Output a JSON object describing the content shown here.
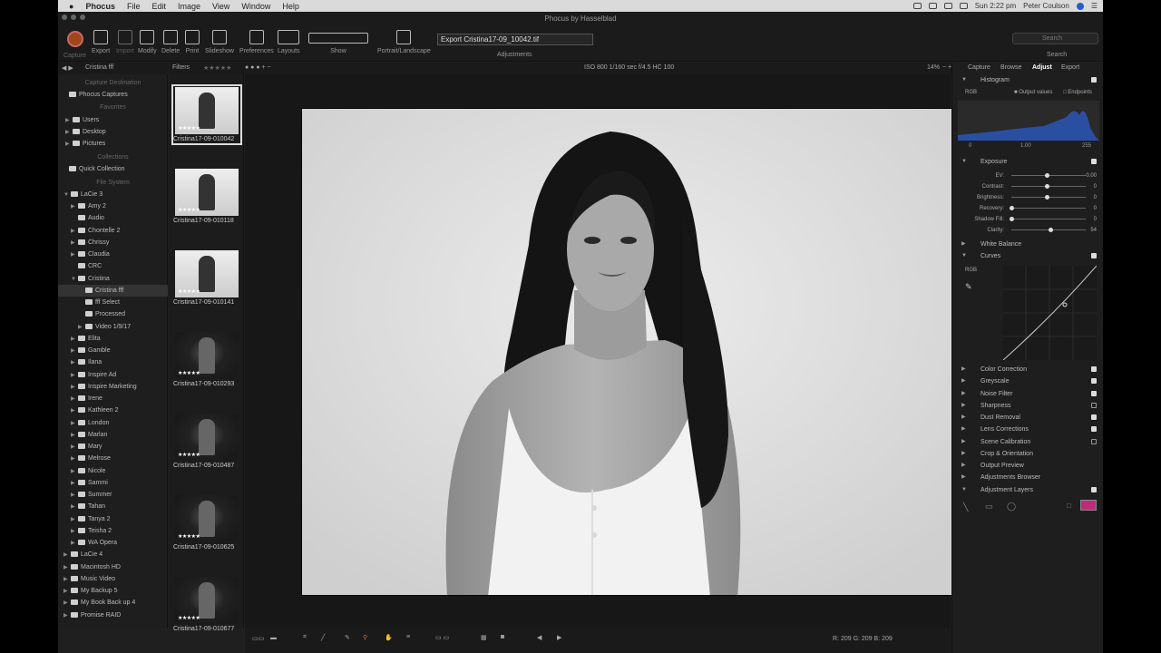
{
  "menubar": {
    "apple": "",
    "app": "Phocus",
    "items": [
      "File",
      "Edit",
      "Image",
      "View",
      "Window",
      "Help"
    ],
    "clock": "Sun 2:22 pm",
    "user": "Peter Coulson"
  },
  "window": {
    "title": "Phocus by Hasselblad"
  },
  "toolbar": {
    "capture": "Capture",
    "export": "Export",
    "import": "Import",
    "modify": "Modify",
    "delete": "Delete",
    "print": "Print",
    "slideshow": "Slideshow",
    "preferences": "Preferences",
    "layouts": "Layouts",
    "show": "Show",
    "portrait": "Portrait/Landscape",
    "adjustments": "Adjustments",
    "export_field": "Export Cristina17-09_10042.tif",
    "search_placeholder": "Search",
    "search_label": "Search"
  },
  "subbar": {
    "folder": "Cristina fff",
    "filters": "Filters",
    "exif": "ISO 800  1/160 sec  f/4.5  HC 100",
    "zoom": "14%"
  },
  "sidebar": {
    "capture_destination": "Capture Destination",
    "phocus_captures": "Phocus Captures",
    "favorites": "Favorites",
    "fav_items": [
      "Users",
      "Desktop",
      "Pictures"
    ],
    "collections": "Collections",
    "quick_collection": "Quick Collection",
    "file_system": "File System",
    "lacie3": "LaCie 3",
    "folders_a": [
      "Amy 2",
      "Audio",
      "Chontelle 2",
      "Chrissy",
      "Claudia",
      "CRC",
      "Cristina"
    ],
    "cristina_children": [
      "Cristina fff",
      "fff Select",
      "Processed",
      "Video 1/9/17"
    ],
    "folders_b": [
      "Elita",
      "Gamble",
      "Ilana",
      "Inspire Ad",
      "Inspire Marketing",
      "Irene",
      "Kathleen 2",
      "London",
      "Marlan",
      "Mary",
      "Melrose",
      "Nicole",
      "Sammi",
      "Summer",
      "Tahan",
      "Tanya 2",
      "Teisha 2",
      "WA Opera"
    ],
    "volumes": [
      "LaCie 4",
      "Macintosh HD",
      "Music Video",
      "My Backup 5",
      "My Book Back up 4",
      "Promise RAID"
    ]
  },
  "thumbs": [
    {
      "name": "Cristina17-09-010042",
      "tone": "light",
      "stars": "★★★★★"
    },
    {
      "name": "Cristina17-09-010118",
      "tone": "light",
      "stars": "★★★★★"
    },
    {
      "name": "Cristina17-09-010141",
      "tone": "light",
      "stars": "★★★★★"
    },
    {
      "name": "Cristina17-09-010293",
      "tone": "dark",
      "stars": "★★★★★"
    },
    {
      "name": "Cristina17-09-010487",
      "tone": "dark",
      "stars": "★★★★★"
    },
    {
      "name": "Cristina17-09-010625",
      "tone": "dark",
      "stars": "★★★★★"
    },
    {
      "name": "Cristina17-09-010677",
      "tone": "dark",
      "stars": "★★★★★"
    }
  ],
  "rightpanel": {
    "tabs": [
      "Capture",
      "Browse",
      "Adjust",
      "Export"
    ],
    "histogram": "Histogram",
    "rgb": "RGB",
    "output_values": "Output values",
    "endpoints": "Endpoints",
    "hist_ticks": [
      "0",
      "1.00",
      "255"
    ],
    "exposure": "Exposure",
    "sliders": [
      {
        "label": "EV:",
        "value": "0.00",
        "pos": 0.48
      },
      {
        "label": "Contrast:",
        "value": "0",
        "pos": 0.48
      },
      {
        "label": "Brightness:",
        "value": "0",
        "pos": 0.48
      },
      {
        "label": "Recovery:",
        "value": "0",
        "pos": 0.0
      },
      {
        "label": "Shadow Fill:",
        "value": "0",
        "pos": 0.0
      },
      {
        "label": "Clarity:",
        "value": "54",
        "pos": 0.52
      }
    ],
    "white_balance": "White Balance",
    "curves": "Curves",
    "curves_rgb": "RGB",
    "sections": [
      "Color Correction",
      "Greyscale",
      "Noise Filter",
      "Sharpness",
      "Dust Removal",
      "Lens Corrections",
      "Scene Calibration",
      "Crop & Orientation",
      "Output Preview",
      "Adjustments Browser",
      "Adjustment Layers"
    ]
  },
  "bottombar": {
    "rgb_readout": "R: 209  G: 209  B: 209"
  },
  "colors": {
    "accent": "#c02a7a",
    "capture": "#a0461d",
    "histogram": "#2b4fa0"
  }
}
